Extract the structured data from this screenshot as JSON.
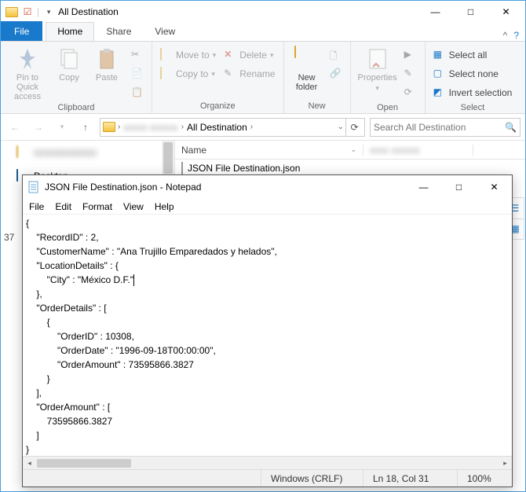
{
  "explorer": {
    "title": "All Destination",
    "qat_sep": "|",
    "win": {
      "min": "—",
      "max": "□",
      "close": "✕"
    },
    "tabs": {
      "file": "File",
      "home": "Home",
      "share": "Share",
      "view": "View"
    },
    "help": {
      "caret": "^",
      "q": "?"
    },
    "ribbon": {
      "clipboard": {
        "label": "Clipboard",
        "pin": "Pin to Quick\naccess",
        "copy": "Copy",
        "paste": "Paste"
      },
      "organize": {
        "label": "Organize",
        "move": "Move to",
        "copyto": "Copy to",
        "delete": "Delete",
        "rename": "Rename"
      },
      "new": {
        "label": "New",
        "newfolder": "New\nfolder"
      },
      "open": {
        "label": "Open",
        "properties": "Properties"
      },
      "select": {
        "label": "Select",
        "all": "Select all",
        "none": "Select none",
        "invert": "Invert selection"
      }
    },
    "address": {
      "seg2": "All Destination",
      "search_ph": "Search All Destination"
    },
    "tree": {
      "desktop": "Desktop"
    },
    "files": {
      "hdr_name": "Name",
      "file1": "JSON File Destination.json"
    },
    "status": {
      "count": "37"
    }
  },
  "notepad": {
    "title": "JSON File Destination.json - Notepad",
    "menu": {
      "file": "File",
      "edit": "Edit",
      "format": "Format",
      "view": "View",
      "help": "Help"
    },
    "content": "{\n    \"RecordID\" : 2,\n    \"CustomerName\" : \"Ana Trujillo Emparedados y helados\",\n    \"LocationDetails\" : {\n        \"City\" : \"México D.F.\"",
    "content2": "\n    },\n    \"OrderDetails\" : [\n        {\n            \"OrderID\" : 10308,\n            \"OrderDate\" : \"1996-09-18T00:00:00\",\n            \"OrderAmount\" : 73595866.3827\n        }\n    ],\n    \"OrderAmount\" : [\n        73595866.3827\n    ]\n}",
    "status": {
      "enc": "Windows (CRLF)",
      "pos": "Ln 18, Col 31",
      "zoom": "100%"
    }
  }
}
